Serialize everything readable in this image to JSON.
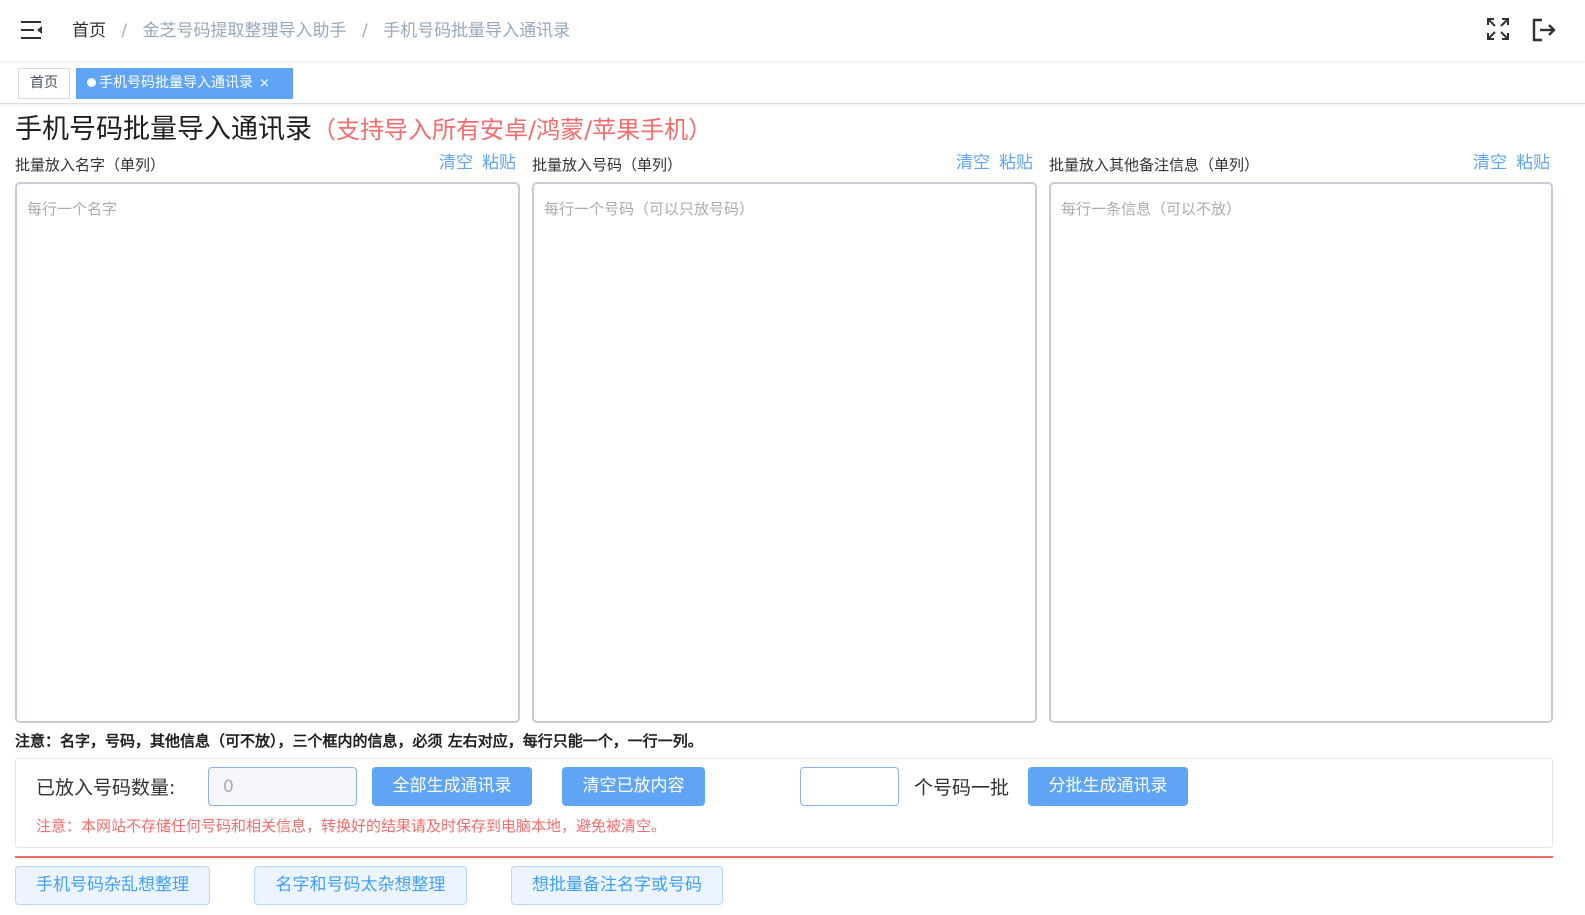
{
  "header": {
    "breadcrumb": [
      "首页",
      "金芝号码提取整理导入助手",
      "手机号码批量导入通讯录"
    ],
    "separator": "/"
  },
  "tags": {
    "home": "首页",
    "active": "手机号码批量导入通讯录",
    "close": "×"
  },
  "page": {
    "title": "手机号码批量导入通讯录",
    "subtitle": "（支持导入所有安卓/鸿蒙/苹果手机）"
  },
  "columns": [
    {
      "label": "批量放入名字（单列）",
      "clear": "清空",
      "paste": "粘贴",
      "placeholder": "每行一个名字"
    },
    {
      "label": "批量放入号码（单列）",
      "clear": "清空",
      "paste": "粘贴",
      "placeholder": "每行一个号码（可以只放号码）"
    },
    {
      "label": "批量放入其他备注信息（单列）",
      "clear": "清空",
      "paste": "粘贴",
      "placeholder": "每行一条信息（可以不放）"
    }
  ],
  "notice": "注意：名字，号码，其他信息（可不放），三个框内的信息，必须 左右对应，每行只能一个，一行一列。",
  "panel": {
    "count_label": "已放入号码数量:",
    "count_value": "0",
    "generate_all": "全部生成通讯录",
    "clear_all": "清空已放内容",
    "batch_label": "个号码一批",
    "batch_generate": "分批生成通讯录",
    "warning": "注意：本网站不存储任何号码和相关信息，转换好的结果请及时保存到电脑本地，避免被清空。"
  },
  "links": [
    "手机号码杂乱想整理",
    "名字和号码太杂想整理",
    "想批量备注名字或号码"
  ],
  "colors": {
    "accent": "#60a5f5",
    "danger": "#f56c6c",
    "light_button_bg": "#ecf5ff"
  },
  "icons": [
    "menu-fold-icon",
    "fullscreen-icon",
    "logout-icon",
    "close-icon"
  ]
}
